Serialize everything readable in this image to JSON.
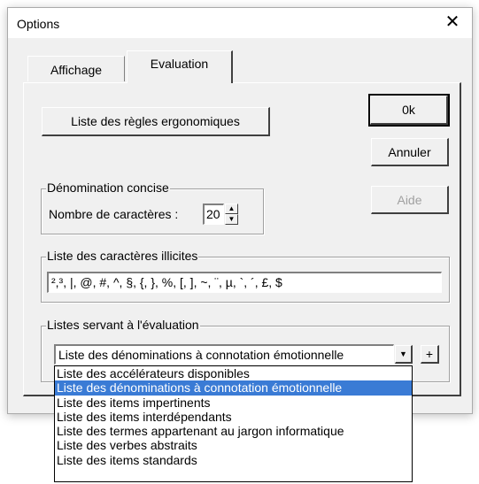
{
  "window": {
    "title": "Options"
  },
  "tabs": [
    {
      "label": "Affichage",
      "active": false
    },
    {
      "label": "Evaluation",
      "active": true
    }
  ],
  "buttons": {
    "rules_list": "Liste des règles ergonomiques",
    "ok": "0k",
    "cancel": "Annuler",
    "help": "Aide",
    "add": "+"
  },
  "denomination": {
    "group_label": "Dénomination concise",
    "chars_label": "Nombre de caractères :",
    "chars_value": "20"
  },
  "illicit": {
    "group_label": "Liste des caractères illicites",
    "value": "²,³, |, @, #, ^, §, {, }, %, [, ], ~, ¨, µ, `, ´, £, $"
  },
  "lists": {
    "group_label": "Listes servant à l'évaluation",
    "selected": "Liste des dénominations à connotation émotionnelle",
    "options": [
      "Liste des accélérateurs disponibles",
      "Liste des dénominations à connotation émotionnelle",
      "Liste des items impertinents",
      "Liste des items interdépendants",
      "Liste des termes appartenant au jargon informatique",
      "Liste des verbes abstraits",
      "Liste des items standards"
    ],
    "highlighted_index": 1
  }
}
